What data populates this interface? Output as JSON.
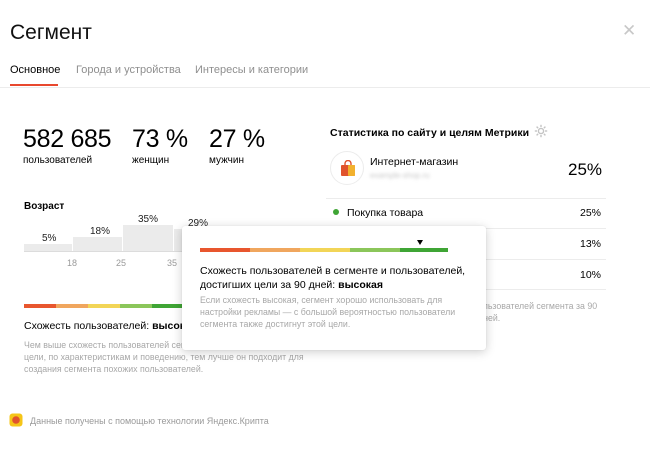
{
  "dialog": {
    "title": "Сегмент",
    "close_icon": "close-icon"
  },
  "tabs": [
    {
      "label": "Основное",
      "active": true
    },
    {
      "label": "Города и устройства",
      "active": false
    },
    {
      "label": "Интересы и категории",
      "active": false
    }
  ],
  "stats": [
    {
      "value": "582 685",
      "label": "пользователей"
    },
    {
      "value": "73 %",
      "label": "женщин"
    },
    {
      "value": "27 %",
      "label": "мужчин"
    }
  ],
  "age": {
    "title": "Возраст",
    "bars": [
      {
        "pct_label": "5%",
        "value": 5
      },
      {
        "pct_label": "18%",
        "value": 18
      },
      {
        "pct_label": "35%",
        "value": 35
      },
      {
        "pct_label": "29%",
        "value": 29
      }
    ],
    "ticks": [
      "18",
      "25",
      "35"
    ]
  },
  "similarity_scale_colors": [
    "#e8562e",
    "#f0a65e",
    "#f2d557",
    "#8bc65a",
    "#3fa535"
  ],
  "similarity": {
    "label": "Схожесть пользователей: ",
    "value": "высокая",
    "description": "Чем выше схожесть пользователей сегмента с теми, кто достиг цели, по характеристикам и поведению, тем лучше он подходит для создания сегмента похожих пользователей."
  },
  "metrika": {
    "title": "Статистика по сайту и целям Метрики",
    "settings_icon": "gear-icon",
    "site": {
      "name": "Интернет-магазин",
      "url": "example-shop.ru",
      "value": "25%",
      "icon": "shopping-bag-icon"
    },
    "goals": [
      {
        "name": "Покупка товара",
        "value": "25%",
        "color": "#3fa535"
      },
      {
        "name": "",
        "value": "13%"
      },
      {
        "name": "",
        "value": "10%"
      }
    ],
    "description": "ользователей сегмента за 90 дней."
  },
  "tooltip": {
    "text": "Схожесть пользователей в сегменте и пользователей, достигших цели за 90 дней: ",
    "value": "высокая",
    "description": "Если схожесть высокая, сегмент хорошо использовать для настройки рекламы — с большой вероятностью пользователи сегмента также достигнут этой цели.",
    "level": 0.8
  },
  "footer": {
    "text": "Данные получены с помощью технологии Яндекс.Крипта",
    "icon": "yandex-crypta-icon"
  }
}
